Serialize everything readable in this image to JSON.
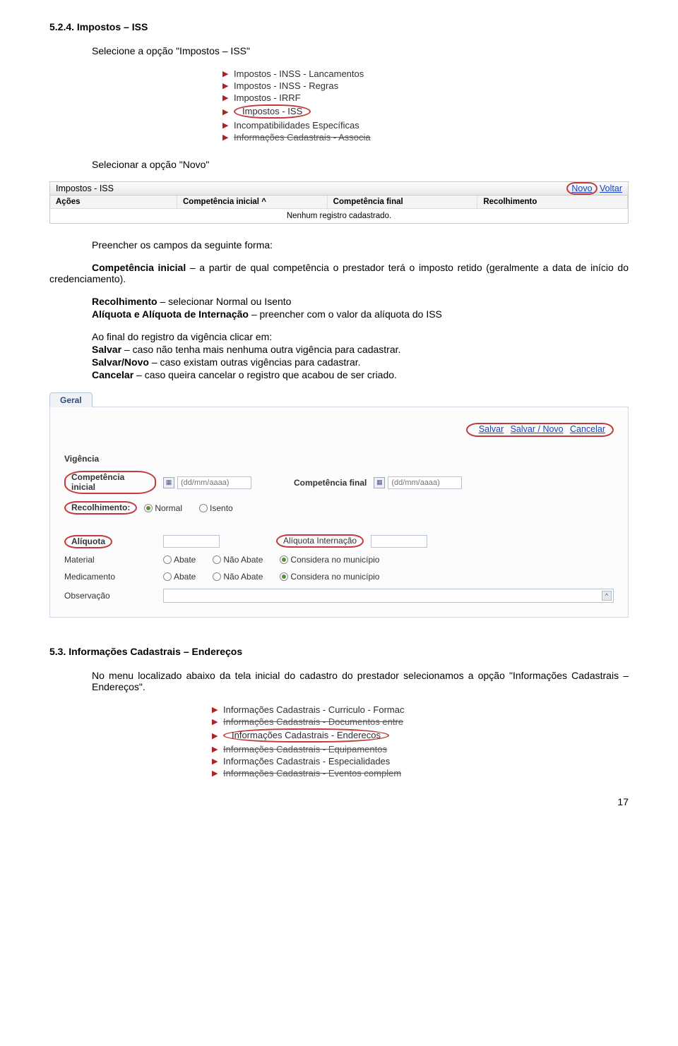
{
  "section1": {
    "heading": "5.2.4. Impostos – ISS",
    "p1": "Selecione a opção \"Impostos – ISS\"",
    "menu_items": [
      {
        "label": "Impostos - INSS - Lancamentos"
      },
      {
        "label": "Impostos - INSS - Regras"
      },
      {
        "label": "Impostos - IRRF"
      },
      {
        "label": "Impostos - ISS",
        "circled": true
      },
      {
        "label": "Incompatibilidades Específicas"
      },
      {
        "label": "Informações Cadastrais - Associa",
        "strike": true
      }
    ],
    "p2": "Selecionar a opção \"Novo\"",
    "grid": {
      "title": "Impostos - ISS",
      "link_novo": "Novo",
      "link_voltar": "Voltar",
      "col1": "Ações",
      "col2": "Competência inicial ^",
      "col3": "Competência final",
      "col4": "Recolhimento",
      "empty": "Nenhum registro cadastrado."
    },
    "p3": "Preencher os campos da seguinte forma:",
    "p4_pre": "Competência inicial",
    "p4_rest": " – a partir de qual competência o prestador terá o imposto retido (geralmente a data de início do credenciamento).",
    "p5a": "Recolhimento",
    "p5b": " – selecionar Normal ou Isento",
    "p6a": "Alíquota e Alíquota de Internação",
    "p6b": " – preencher com o valor da alíquota do ISS",
    "p7": "Ao final do registro da vigência clicar em:",
    "p8a": "Salvar",
    "p8b": " – caso não tenha mais nenhuma outra vigência para cadastrar.",
    "p9a": "Salvar/Novo",
    "p9b": " – caso existam outras vigências para cadastrar.",
    "p10a": "Cancelar",
    "p10b": " – caso queira cancelar o registro que acabou de ser criado."
  },
  "form": {
    "tab": "Geral",
    "actions": {
      "salvar": "Salvar",
      "salvar_novo": "Salvar / Novo",
      "cancelar": "Cancelar"
    },
    "vigencia": "Vigência",
    "comp_ini": "Competência inicial",
    "comp_fim": "Competência final",
    "date_ph": "(dd/mm/aaaa)",
    "recolhimento": "Recolhimento:",
    "opt_normal": "Normal",
    "opt_isento": "Isento",
    "aliquota": "Alíquota",
    "aliquota_int": "Alíquota Internação",
    "material": "Material",
    "medicamento": "Medicamento",
    "abate": "Abate",
    "nao_abate": "Não Abate",
    "considera": "Considera no município",
    "observacao": "Observação"
  },
  "section2": {
    "heading": "5.3. Informações Cadastrais – Endereços",
    "p1": "No menu localizado abaixo da tela inicial do cadastro do prestador selecionamos a opção \"Informações Cadastrais – Endereços\".",
    "menu_items": [
      {
        "label": "Informações Cadastrais - Curriculo - Formac"
      },
      {
        "label": "Informações Cadastrais - Documentos entre",
        "strike": true
      },
      {
        "label": "Informações Cadastrais - Enderecos",
        "circled": true
      },
      {
        "label": "Informações Cadastrais - Equipamentos",
        "strike": true
      },
      {
        "label": "Informações Cadastrais - Especialidades"
      },
      {
        "label": "Informações Cadastrais - Eventos complem",
        "strike": true
      }
    ]
  },
  "page_num": "17"
}
